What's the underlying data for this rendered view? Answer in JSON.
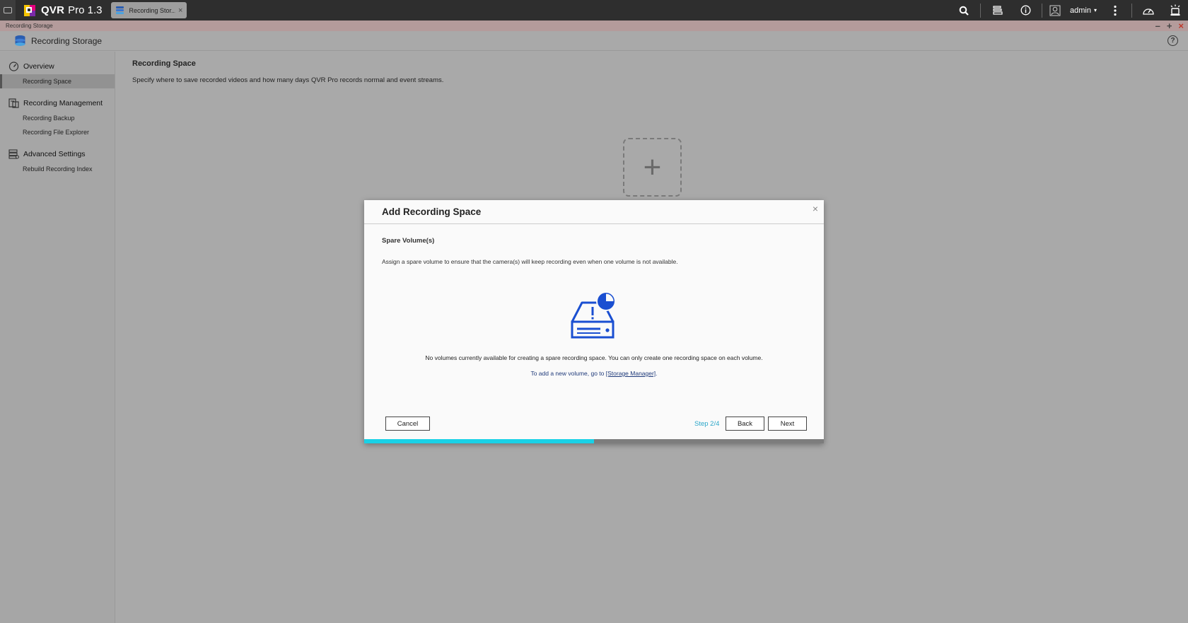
{
  "topbar": {
    "brand_name": "QVR",
    "brand_version": "Pro 1.3",
    "tab_label": "Recording Stor...",
    "tab_close": "×",
    "user": "admin",
    "user_caret": "▾",
    "icons": [
      "search-icon",
      "task-stack-icon",
      "info-icon",
      "user-icon",
      "more-vertical-icon",
      "dashboard-icon",
      "alarm-icon"
    ]
  },
  "titlestrip": {
    "label": "Recording Storage",
    "minimize": "–",
    "maximize": "+",
    "close": "×"
  },
  "app_header": {
    "title": "Recording Storage",
    "help": "?"
  },
  "sidebar": {
    "groups": [
      {
        "label": "Overview",
        "icon": "gauge-icon",
        "items": [
          {
            "label": "Recording Space",
            "active": true
          }
        ]
      },
      {
        "label": "Recording Management",
        "icon": "file-management-icon",
        "items": [
          {
            "label": "Recording Backup"
          },
          {
            "label": "Recording File Explorer"
          }
        ]
      },
      {
        "label": "Advanced Settings",
        "icon": "settings-database-icon",
        "items": [
          {
            "label": "Rebuild Recording Index"
          }
        ]
      }
    ]
  },
  "main": {
    "title": "Recording Space",
    "description": "Specify where to save recorded videos and how many days QVR Pro records normal and event streams.",
    "add_icon": "+"
  },
  "dialog": {
    "title": "Add Recording Space",
    "close": "×",
    "section": "Spare Volume(s)",
    "description": "Assign a spare volume to ensure that the camera(s) will keep recording even when one volume is not available.",
    "illustration_icon": "disk-warning-icon",
    "message": "No volumes currently available for creating a spare recording space. You can only create one recording space on each volume.",
    "hint_prefix": "To add a new volume, go to ",
    "hint_link": "[Storage Manager]",
    "hint_suffix": ".",
    "cancel": "Cancel",
    "step": "Step 2/4",
    "back": "Back",
    "next": "Next",
    "progress_fraction": 0.5,
    "accent_color": "#19d1e6",
    "illustration_color": "#1a4fd1"
  }
}
